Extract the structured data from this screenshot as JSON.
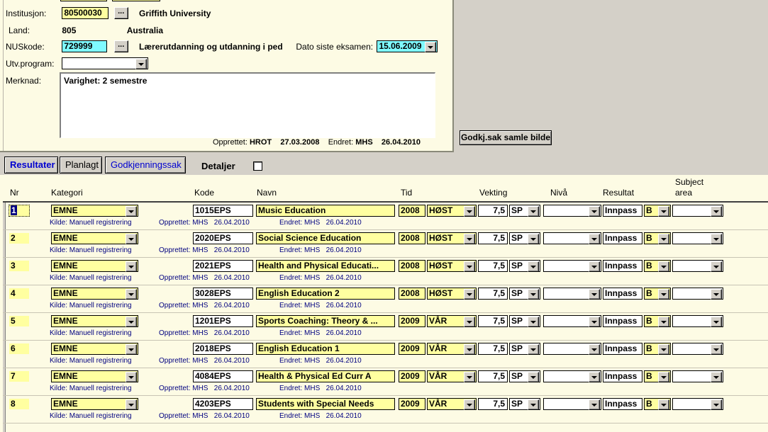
{
  "form": {
    "institusjon": {
      "label": "Institusjon:",
      "value": "80500030",
      "browse": "...",
      "name": "Griffith University"
    },
    "land": {
      "label": "Land:",
      "value": "805",
      "name": "Australia"
    },
    "nuskode": {
      "label": "NUSkode:",
      "value": "729999",
      "browse": "...",
      "name": "Lærerutdanning og utdanning i ped"
    },
    "dato_siste_eksamen": {
      "label": "Dato siste eksamen:",
      "value": "15.06.2009"
    },
    "utv_program": {
      "label": "Utv.program:",
      "value": ""
    },
    "merknad": {
      "label": "Merknad:",
      "value": "Varighet: 2 semestre"
    },
    "audit": {
      "opprettet_label": "Opprettet:",
      "opprettet_user": "HROT",
      "opprettet_date": "27.03.2008",
      "endret_label": "Endret:",
      "endret_user": "MHS",
      "endret_date": "26.04.2010"
    },
    "godkj_button": "Godkj.sak samle bilde"
  },
  "tabs": {
    "items": [
      {
        "label": "Resultater",
        "active": true
      },
      {
        "label": "Planlagt",
        "active": false
      },
      {
        "label": "Godkjenningssak",
        "active": false
      }
    ],
    "detaljer_label": "Detaljer",
    "detaljer_checked": false
  },
  "grid": {
    "headers": {
      "nr": "Nr",
      "kategori": "Kategori",
      "kode": "Kode",
      "navn": "Navn",
      "tid": "Tid",
      "vekting": "Vekting",
      "niva": "Nivå",
      "resultat": "Resultat",
      "subject_area_l1": "Subject",
      "subject_area_l2": "area"
    },
    "sub_labels": {
      "kilde": "Kilde: Manuell registrering",
      "opprettet": "Opprettet:",
      "endret": "Endret:"
    },
    "rows": [
      {
        "nr": "1",
        "selected": true,
        "kategori": "EMNE",
        "kode": "1015EPS",
        "navn": "Music Education",
        "tid_year": "2008",
        "tid_term": "HØST",
        "vekt": "7,5",
        "vekt_unit": "SP",
        "niva": "",
        "resultat": "Innpass",
        "karakter": "B",
        "subject_area": "",
        "kilde": "Kilde: Manuell registrering",
        "opprettet_user": "MHS",
        "opprettet_date": "26.04.2010",
        "endret_user": "MHS",
        "endret_date": "26.04.2010"
      },
      {
        "nr": "2",
        "selected": false,
        "kategori": "EMNE",
        "kode": "2020EPS",
        "navn": "Social Science Education",
        "tid_year": "2008",
        "tid_term": "HØST",
        "vekt": "7,5",
        "vekt_unit": "SP",
        "niva": "",
        "resultat": "Innpass",
        "karakter": "B",
        "subject_area": "",
        "kilde": "Kilde: Manuell registrering",
        "opprettet_user": "MHS",
        "opprettet_date": "26.04.2010",
        "endret_user": "MHS",
        "endret_date": "26.04.2010"
      },
      {
        "nr": "3",
        "selected": false,
        "kategori": "EMNE",
        "kode": "2021EPS",
        "navn": "Health and Physical Educati...",
        "tid_year": "2008",
        "tid_term": "HØST",
        "vekt": "7,5",
        "vekt_unit": "SP",
        "niva": "",
        "resultat": "Innpass",
        "karakter": "B",
        "subject_area": "",
        "kilde": "Kilde: Manuell registrering",
        "opprettet_user": "MHS",
        "opprettet_date": "26.04.2010",
        "endret_user": "MHS",
        "endret_date": "26.04.2010"
      },
      {
        "nr": "4",
        "selected": false,
        "kategori": "EMNE",
        "kode": "3028EPS",
        "navn": "English Education 2",
        "tid_year": "2008",
        "tid_term": "HØST",
        "vekt": "7,5",
        "vekt_unit": "SP",
        "niva": "",
        "resultat": "Innpass",
        "karakter": "B",
        "subject_area": "",
        "kilde": "Kilde: Manuell registrering",
        "opprettet_user": "MHS",
        "opprettet_date": "26.04.2010",
        "endret_user": "MHS",
        "endret_date": "26.04.2010"
      },
      {
        "nr": "5",
        "selected": false,
        "kategori": "EMNE",
        "kode": "1201EPS",
        "navn": "Sports Coaching: Theory & ...",
        "tid_year": "2009",
        "tid_term": "VÅR",
        "vekt": "7,5",
        "vekt_unit": "SP",
        "niva": "",
        "resultat": "Innpass",
        "karakter": "B",
        "subject_area": "",
        "kilde": "Kilde: Manuell registrering",
        "opprettet_user": "MHS",
        "opprettet_date": "26.04.2010",
        "endret_user": "MHS",
        "endret_date": "26.04.2010"
      },
      {
        "nr": "6",
        "selected": false,
        "kategori": "EMNE",
        "kode": "2018EPS",
        "navn": "English Education 1",
        "tid_year": "2009",
        "tid_term": "VÅR",
        "vekt": "7,5",
        "vekt_unit": "SP",
        "niva": "",
        "resultat": "Innpass",
        "karakter": "B",
        "subject_area": "",
        "kilde": "Kilde: Manuell registrering",
        "opprettet_user": "MHS",
        "opprettet_date": "26.04.2010",
        "endret_user": "MHS",
        "endret_date": "26.04.2010"
      },
      {
        "nr": "7",
        "selected": false,
        "kategori": "EMNE",
        "kode": "4084EPS",
        "navn": "Health & Physical Ed Curr A",
        "tid_year": "2009",
        "tid_term": "VÅR",
        "vekt": "7,5",
        "vekt_unit": "SP",
        "niva": "",
        "resultat": "Innpass",
        "karakter": "B",
        "subject_area": "",
        "kilde": "Kilde: Manuell registrering",
        "opprettet_user": "MHS",
        "opprettet_date": "26.04.2010",
        "endret_user": "MHS",
        "endret_date": "26.04.2010"
      },
      {
        "nr": "8",
        "selected": false,
        "kategori": "EMNE",
        "kode": "4203EPS",
        "navn": "Students with Special Needs",
        "tid_year": "2009",
        "tid_term": "VÅR",
        "vekt": "7,5",
        "vekt_unit": "SP",
        "niva": "",
        "resultat": "Innpass",
        "karakter": "B",
        "subject_area": "",
        "kilde": "Kilde: Manuell registrering",
        "opprettet_user": "MHS",
        "opprettet_date": "26.04.2010",
        "endret_user": "MHS",
        "endret_date": "26.04.2010"
      }
    ]
  },
  "colors": {
    "field_yellow": "#ffffa0",
    "field_cyan": "#7ffaff",
    "panel_cream": "#fdfbe4",
    "chrome_gray": "#d4d0c8",
    "link_blue": "#0000d0",
    "sub_blue": "#000080"
  }
}
